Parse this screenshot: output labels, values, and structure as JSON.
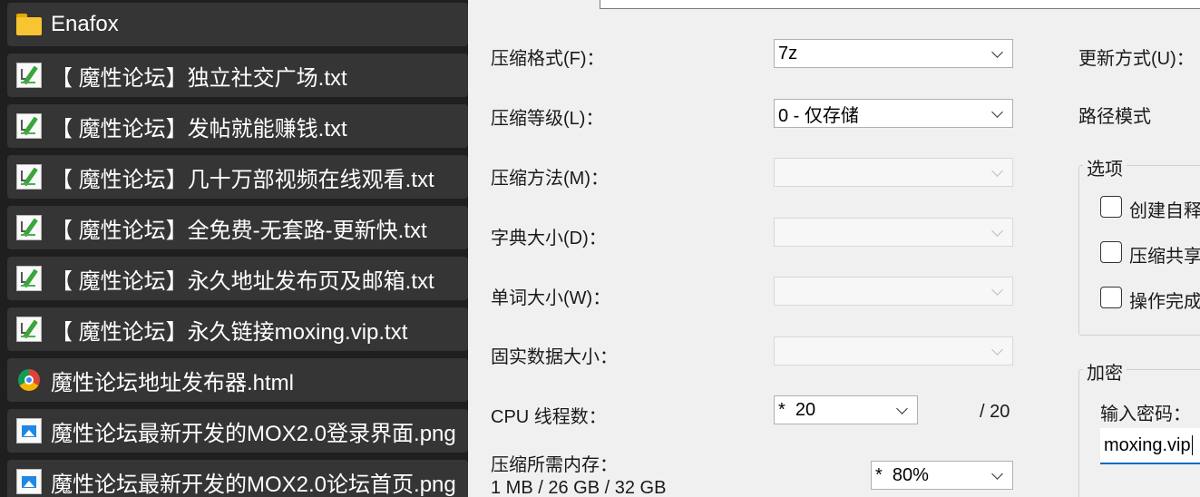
{
  "files": [
    {
      "name": "Enafox",
      "icon": "folder-icon"
    },
    {
      "name": "【 魔性论坛】独立社交广场.txt",
      "icon": "text-file-icon"
    },
    {
      "name": "【 魔性论坛】发帖就能赚钱.txt",
      "icon": "text-file-icon"
    },
    {
      "name": "【 魔性论坛】几十万部视频在线观看.txt",
      "icon": "text-file-icon"
    },
    {
      "name": "【 魔性论坛】全免费-无套路-更新快.txt",
      "icon": "text-file-icon"
    },
    {
      "name": "【 魔性论坛】永久地址发布页及邮箱.txt",
      "icon": "text-file-icon"
    },
    {
      "name": "【 魔性论坛】永久链接moxing.vip.txt",
      "icon": "text-file-icon"
    },
    {
      "name": "魔性论坛地址发布器.html",
      "icon": "chrome-icon"
    },
    {
      "name": "魔性论坛最新开发的MOX2.0登录界面.png",
      "icon": "image-file-icon"
    },
    {
      "name": "魔性论坛最新开发的MOX2.0论坛首页.png",
      "icon": "image-file-icon"
    }
  ],
  "dialog": {
    "format": {
      "label": "压缩格式(F)：",
      "value": "7z"
    },
    "level": {
      "label": "压缩等级(L)：",
      "value": "0 - 仅存储"
    },
    "method": {
      "label": "压缩方法(M)：",
      "value": ""
    },
    "dict": {
      "label": "字典大小(D)：",
      "value": ""
    },
    "word": {
      "label": "单词大小(W)：",
      "value": ""
    },
    "solid": {
      "label": "固实数据大小：",
      "value": ""
    },
    "threads": {
      "label": "CPU 线程数：",
      "value": "*  20",
      "max": "/ 20"
    },
    "memory": {
      "label": "压缩所需内存：",
      "detail": "1 MB / 26 GB / 32 GB",
      "value": "*  80%"
    },
    "update_mode": {
      "label": "更新方式(U)："
    },
    "path_mode": {
      "label": "路径模式"
    },
    "options": {
      "title": "选项",
      "items": [
        "创建自释",
        "压缩共享",
        "操作完成"
      ]
    },
    "encryption": {
      "title": "加密",
      "password_label": "输入密码：",
      "password_value": "moxing.vip"
    }
  }
}
